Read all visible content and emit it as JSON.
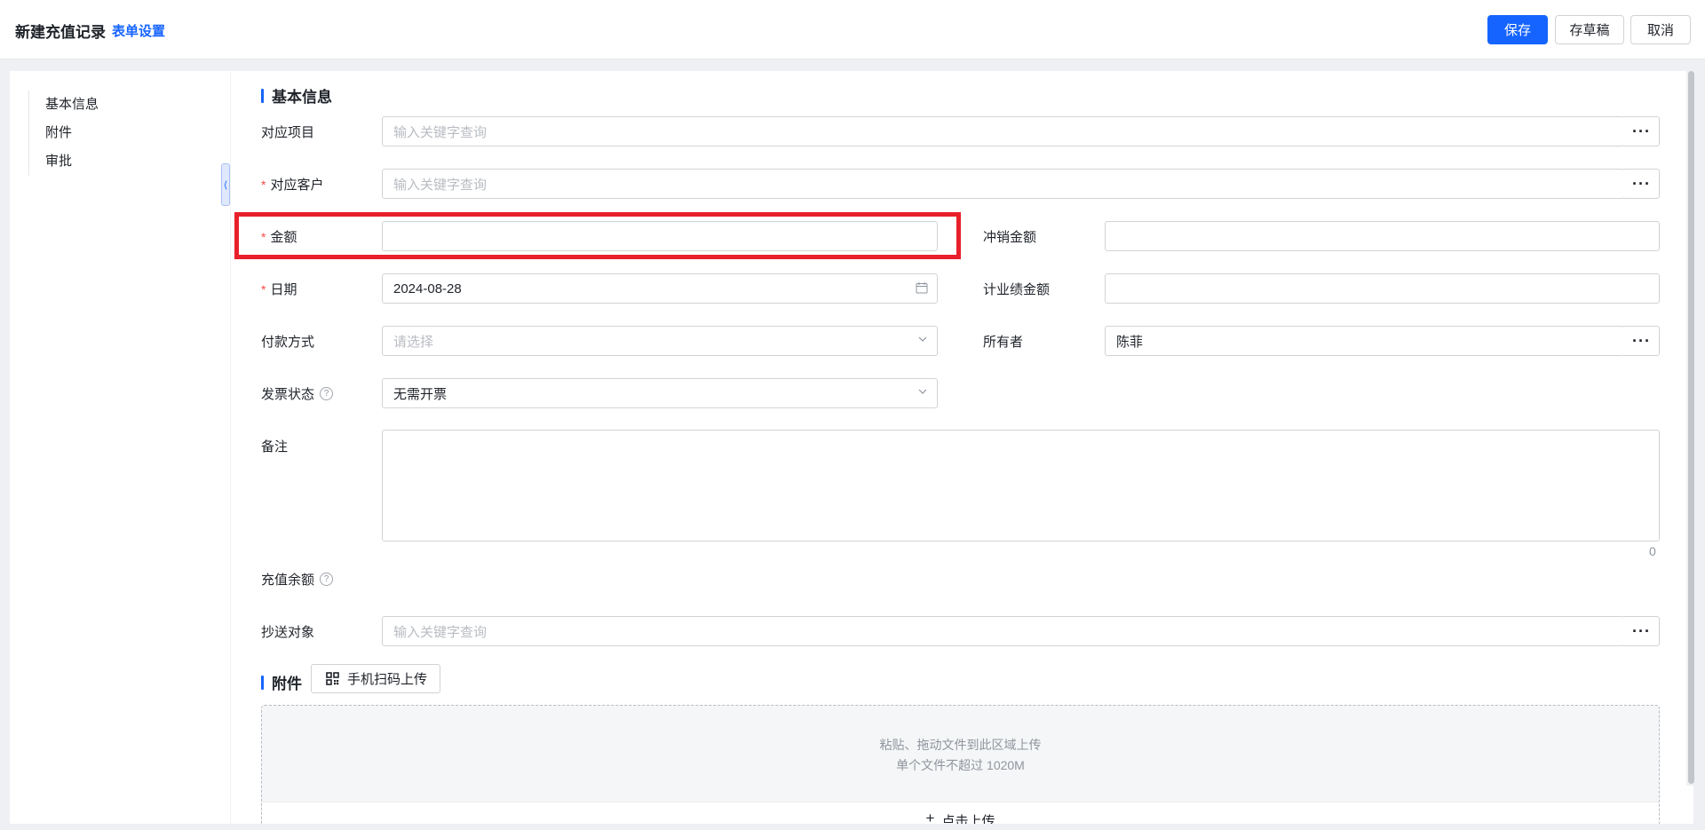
{
  "header": {
    "title": "新建充值记录",
    "form_settings": "表单设置",
    "save": "保存",
    "save_draft": "存草稿",
    "cancel": "取消"
  },
  "sidebar": {
    "items": [
      {
        "label": "基本信息"
      },
      {
        "label": "附件"
      },
      {
        "label": "审批"
      }
    ]
  },
  "sections": {
    "basic": "基本信息",
    "attachments": "附件"
  },
  "fields": {
    "project": {
      "label": "对应项目",
      "placeholder": "输入关键字查询"
    },
    "customer": {
      "label": "对应客户",
      "placeholder": "输入关键字查询",
      "required_mark": "*"
    },
    "amount": {
      "label": "金额",
      "value": "",
      "required_mark": "*"
    },
    "writeoff": {
      "label": "冲销金额",
      "value": ""
    },
    "date": {
      "label": "日期",
      "value": "2024-08-28",
      "required_mark": "*"
    },
    "performance": {
      "label": "计业绩金额",
      "value": ""
    },
    "payment": {
      "label": "付款方式",
      "placeholder": "请选择"
    },
    "owner": {
      "label": "所有者",
      "value": "陈菲"
    },
    "invoice": {
      "label": "发票状态",
      "value": "无需开票"
    },
    "remark": {
      "label": "备注",
      "char_count": "0"
    },
    "balance": {
      "label": "充值余额"
    },
    "cc": {
      "label": "抄送对象",
      "placeholder": "输入关键字查询"
    }
  },
  "attachments": {
    "scan_button": "手机扫码上传",
    "drop_hint_line1": "粘贴、拖动文件到此区域上传",
    "drop_hint_line2": "单个文件不超过 1020M",
    "click_upload": "点击上传"
  },
  "icons": {
    "more": "more-icon",
    "calendar": "calendar-icon",
    "chevron": "chevron-down-icon",
    "help": "help-circle-icon",
    "qr": "qr-code-icon",
    "plus": "plus-icon"
  },
  "colors": {
    "primary": "#1664ff",
    "required": "#f54a45",
    "highlight": "#e8202a"
  }
}
